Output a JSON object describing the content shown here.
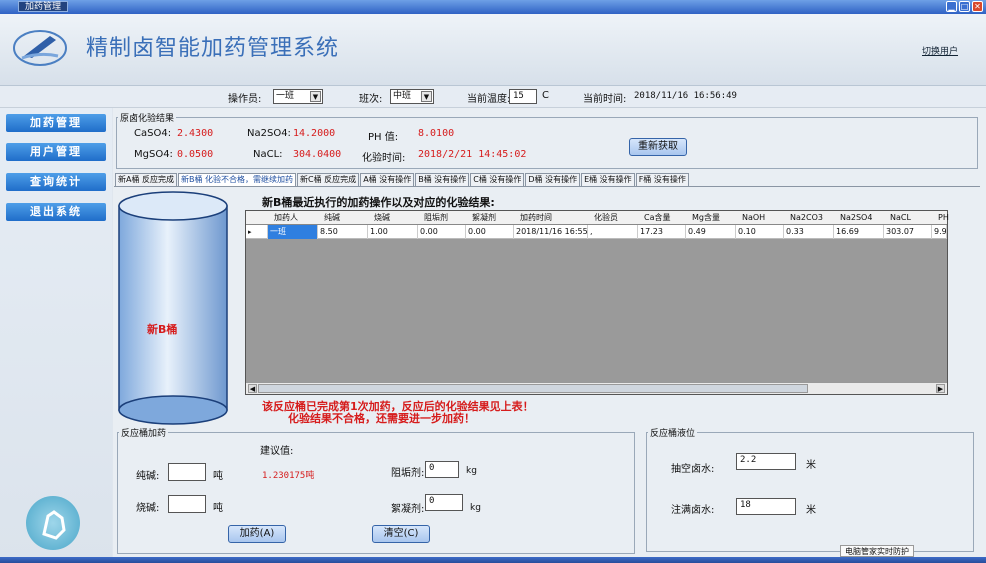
{
  "window": {
    "title": "加药管理"
  },
  "header": {
    "app_title": "精制卤智能加药管理系统",
    "switch_user": "切换用户"
  },
  "opbar": {
    "operator_label": "操作员:",
    "operator_value": "一班",
    "shift_label": "班次:",
    "shift_value": "中班",
    "temp_label": "当前温度:",
    "temp_value": "15",
    "temp_unit": "C",
    "time_label": "当前时间:",
    "time_value": "2018/11/16 16:56:49"
  },
  "sidebar": {
    "items": [
      {
        "label": "加药管理"
      },
      {
        "label": "用户管理"
      },
      {
        "label": "查询统计"
      },
      {
        "label": "退出系统"
      }
    ]
  },
  "raw_result": {
    "legend": "原卤化验结果",
    "caso4_label": "CaSO4:",
    "caso4_value": "2.4300",
    "na2so4_label": "Na2SO4:",
    "na2so4_value": "14.2000",
    "ph_label": "PH  值:",
    "ph_value": "8.0100",
    "mgso4_label": "MgSO4:",
    "mgso4_value": "0.0500",
    "nacl_label": "NaCL:",
    "nacl_value": "304.0400",
    "test_time_label": "化验时间:",
    "test_time_value": "2018/2/21 14:45:02",
    "refresh_button": "重新获取"
  },
  "tabs": [
    {
      "label": "新A桶 反应完成"
    },
    {
      "label": "新B桶 化验不合格，需继续加药",
      "active": true
    },
    {
      "label": "新C桶 反应完成"
    },
    {
      "label": "A桶 没有操作"
    },
    {
      "label": "B桶 没有操作"
    },
    {
      "label": "C桶 没有操作"
    },
    {
      "label": "D桶 没有操作"
    },
    {
      "label": "E桶 没有操作"
    },
    {
      "label": "F桶 没有操作"
    }
  ],
  "tank": {
    "label": "新B桶",
    "color": "#d61c1c"
  },
  "grid": {
    "title": "新B桶最近执行的加药操作以及对应的化验结果:",
    "columns": [
      "加药人",
      "纯碱",
      "烧碱",
      "阻垢剂",
      "絮凝剂",
      "加药时间",
      "化验员",
      "Ca含量",
      "Mg含量",
      "NaOH",
      "Na2CO3",
      "Na2SO4",
      "NaCL",
      "PH"
    ],
    "rows": [
      [
        "一班",
        "8.50",
        "1.00",
        "0.00",
        "0.00",
        "2018/11/16 16:55",
        ",",
        "17.23",
        "0.49",
        "0.10",
        "0.33",
        "16.69",
        "303.07",
        "9.9"
      ]
    ]
  },
  "message": {
    "line1": "该反应桶已完成第1次加药，反应后的化验结果见上表！",
    "line2": "化验结果不合格，还需要进一步加药！"
  },
  "dosing": {
    "legend": "反应桶加药",
    "suggest_label": "建议值:",
    "soda_label": "纯碱:",
    "soda_unit": "吨",
    "soda_value": "",
    "suggest_value": "1.230175吨",
    "caustic_label": "烧碱:",
    "caustic_unit": "吨",
    "caustic_value": "",
    "antiscale_label": "阻垢剂:",
    "antiscale_value": "0",
    "antiscale_unit": "kg",
    "floc_label": "絮凝剂:",
    "floc_value": "0",
    "floc_unit": "kg",
    "dose_button": "加药(A)",
    "clear_button": "清空(C)"
  },
  "level": {
    "legend": "反应桶液位",
    "pump_empty_label": "抽空卤水:",
    "pump_empty_value": "2.2",
    "pump_empty_unit": "米",
    "fill_label": "注满卤水:",
    "fill_value": "18",
    "fill_unit": "米"
  },
  "tooltip": "电脑管家实时防护",
  "colors": {
    "accent": "#1f6dc9",
    "alert": "#d61c1c"
  }
}
